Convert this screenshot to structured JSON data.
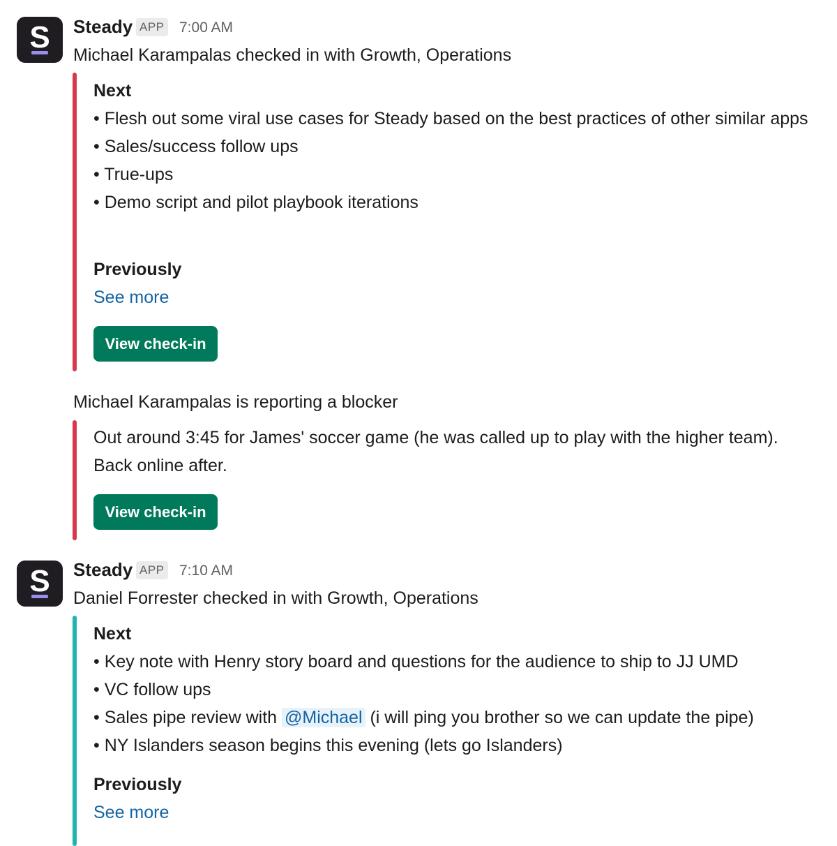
{
  "messages": [
    {
      "sender": "Steady",
      "badge": "APP",
      "time": "7:00 AM",
      "avatar_letter": "S",
      "avatar_icon": "steady-logo-icon",
      "intro": "Michael Karampalas checked in with Growth, Operations",
      "next_heading": "Next",
      "next_items": [
        "• Flesh out some viral use cases for Steady based on the best practices of other similar apps",
        "• Sales/success follow ups",
        "• True-ups",
        "• Demo script and pilot playbook iterations"
      ],
      "previously_heading": "Previously",
      "see_more": "See more",
      "button": "View check-in",
      "blocker_intro": "Michael Karampalas is reporting a blocker",
      "blocker_lines": [
        "Out around 3:45 for James' soccer game (he was called up to play with the higher team).",
        "Back online after."
      ],
      "blocker_button": "View check-in",
      "accent_color": "#d6394f"
    },
    {
      "sender": "Steady",
      "badge": "APP",
      "time": "7:10 AM",
      "avatar_letter": "S",
      "avatar_icon": "steady-logo-icon",
      "intro": "Daniel Forrester checked in with Growth, Operations",
      "next_heading": "Next",
      "next_items": [
        "• Key note with Henry story board and questions for the audience to ship to JJ UMD",
        "• VC follow ups"
      ],
      "mention_item": {
        "before": "• Sales pipe review with ",
        "mention": "@Michael",
        "after": " (i will ping you brother so we can update the pipe)"
      },
      "last_item": "• NY Islanders season begins this evening (lets go Islanders)",
      "previously_heading": "Previously",
      "see_more": "See more",
      "accent_color": "#1db5ae"
    }
  ],
  "colors": {
    "button_bg": "#007a5a",
    "link": "#1264a3",
    "avatar_bg": "#1f1d22",
    "avatar_bar": "#9b8cf2"
  }
}
